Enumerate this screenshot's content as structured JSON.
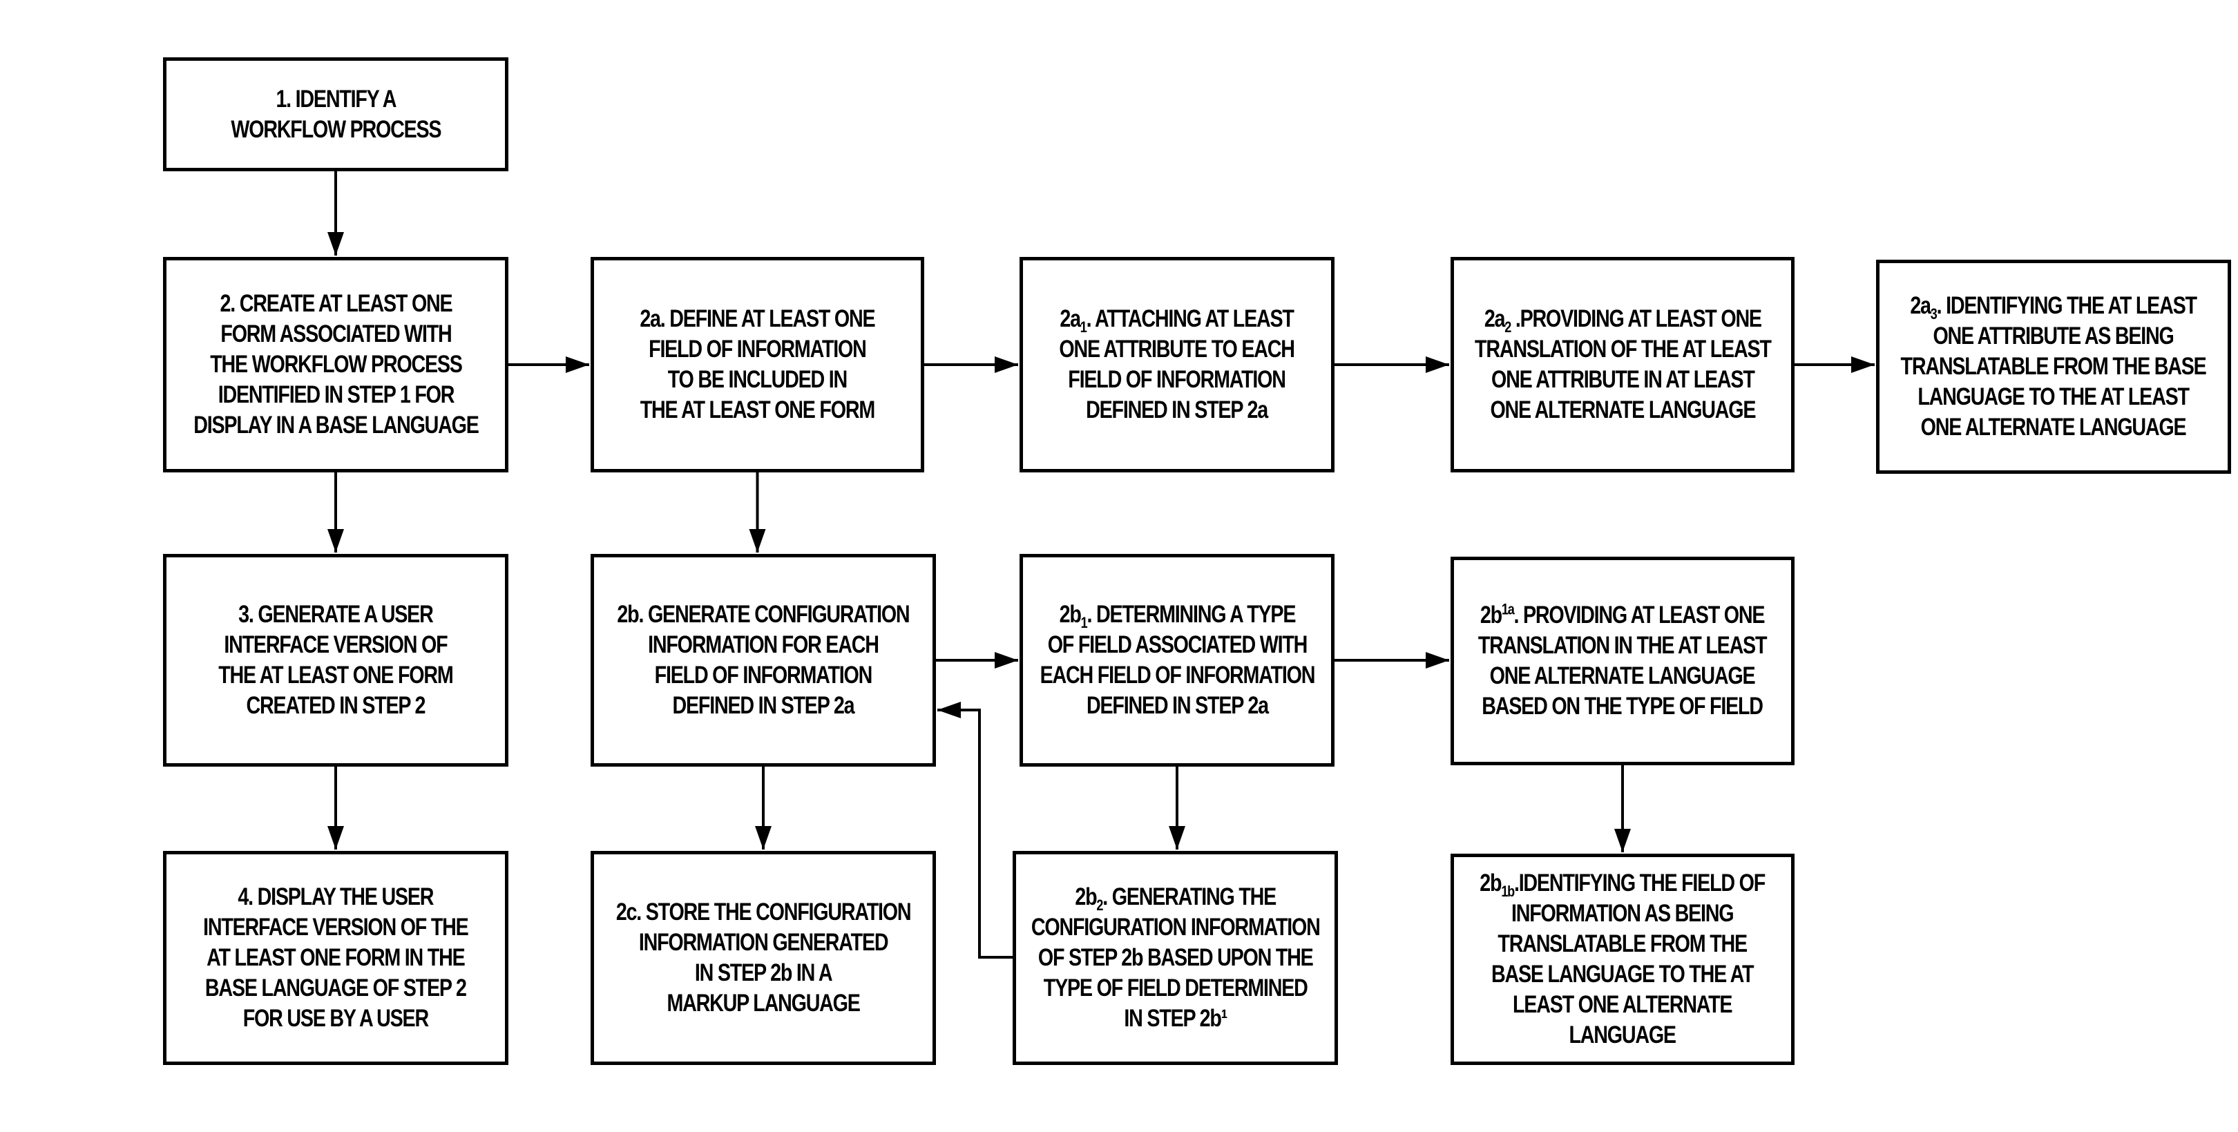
{
  "diagram": {
    "type": "flowchart",
    "colors": {
      "stroke": "#000000",
      "background": "#ffffff",
      "text": "#000000"
    },
    "nodes": [
      {
        "id": "1",
        "prefix": "1.",
        "sub": "",
        "sup": "",
        "sep": "  ",
        "lines": [
          "IDENTIFY A",
          "WORKFLOW PROCESS"
        ]
      },
      {
        "id": "2",
        "prefix": "2.",
        "sub": "",
        "sup": "",
        "sep": "  ",
        "lines": [
          "CREATE AT LEAST ONE",
          "FORM ASSOCIATED WITH",
          "THE WORKFLOW PROCESS",
          "IDENTIFIED IN STEP 1 FOR",
          "DISPLAY IN A BASE LANGUAGE"
        ]
      },
      {
        "id": "2a",
        "prefix": "2a.",
        "sub": "",
        "sup": "",
        "sep": "  ",
        "lines": [
          "DEFINE AT LEAST ONE",
          "FIELD OF INFORMATION",
          "TO BE INCLUDED IN",
          "THE AT LEAST ONE FORM"
        ]
      },
      {
        "id": "2a1",
        "prefix": "2a",
        "sub": "1",
        "sup": "",
        "sep": ". ",
        "lines": [
          "ATTACHING AT LEAST",
          "ONE ATTRIBUTE TO EACH",
          "FIELD OF INFORMATION",
          "DEFINED IN STEP 2a"
        ]
      },
      {
        "id": "2a2",
        "prefix": "2a",
        "sub": "2",
        "sup": "",
        "sep": " .",
        "lines": [
          "PROVIDING AT LEAST ONE",
          "TRANSLATION OF THE AT LEAST",
          "ONE ATTRIBUTE IN AT LEAST",
          "ONE ALTERNATE LANGUAGE"
        ]
      },
      {
        "id": "2a3",
        "prefix": "2a",
        "sub": "3",
        "sup": "",
        "sep": ". ",
        "lines": [
          "IDENTIFYING THE AT LEAST",
          "ONE ATTRIBUTE AS BEING",
          "TRANSLATABLE FROM THE BASE",
          "LANGUAGE TO THE AT LEAST",
          "ONE ALTERNATE LANGUAGE"
        ]
      },
      {
        "id": "3",
        "prefix": "3.",
        "sub": "",
        "sup": "",
        "sep": "  ",
        "lines": [
          "GENERATE A USER",
          "INTERFACE VERSION OF",
          "THE AT LEAST ONE FORM",
          "CREATED IN STEP 2"
        ]
      },
      {
        "id": "2b",
        "prefix": "2b.",
        "sub": "",
        "sup": "",
        "sep": " ",
        "lines": [
          "GENERATE CONFIGURATION",
          "INFORMATION FOR EACH",
          "FIELD OF INFORMATION",
          "DEFINED IN STEP 2a"
        ]
      },
      {
        "id": "2b1",
        "prefix": "2b",
        "sub": "1",
        "sup": "",
        "sep": ". ",
        "lines": [
          "DETERMINING A TYPE",
          "OF FIELD ASSOCIATED WITH",
          "EACH FIELD OF INFORMATION",
          "DEFINED IN STEP 2a"
        ]
      },
      {
        "id": "2b1a",
        "prefix": "2b",
        "sub": "",
        "sup": "1a",
        "sep": ". ",
        "lines": [
          "PROVIDING AT LEAST ONE",
          "TRANSLATION IN THE AT LEAST",
          "ONE ALTERNATE LANGUAGE",
          "BASED ON THE TYPE OF FIELD"
        ]
      },
      {
        "id": "4",
        "prefix": "4.",
        "sub": "",
        "sup": "",
        "sep": "  ",
        "lines": [
          "DISPLAY THE USER",
          "INTERFACE VERSION OF THE",
          "AT LEAST ONE FORM IN THE",
          "BASE LANGUAGE OF STEP 2",
          "FOR USE BY A USER"
        ]
      },
      {
        "id": "2c",
        "prefix": "2c.",
        "sub": "",
        "sup": "",
        "sep": " ",
        "lines": [
          "STORE THE CONFIGURATION",
          "INFORMATION GENERATED",
          "IN STEP 2b IN A",
          "MARKUP LANGUAGE"
        ]
      },
      {
        "id": "2b2",
        "prefix": "2b",
        "sub": "2",
        "sup": "",
        "sep": ". ",
        "lines": [
          "GENERATING THE",
          "CONFIGURATION INFORMATION",
          "OF STEP 2b BASED UPON THE",
          "TYPE OF FIELD DETERMINED",
          "IN STEP 2b¹"
        ]
      },
      {
        "id": "2b1b",
        "prefix": "2b",
        "sub": "1b",
        "sup": "",
        "sep": ".",
        "lines": [
          "IDENTIFYING THE FIELD OF",
          "INFORMATION AS BEING",
          "TRANSLATABLE FROM THE",
          "BASE LANGUAGE TO THE AT",
          "LEAST ONE ALTERNATE",
          "LANGUAGE"
        ]
      }
    ],
    "edges": [
      {
        "from": "1",
        "to": "2"
      },
      {
        "from": "2",
        "to": "2a"
      },
      {
        "from": "2a",
        "to": "2a1"
      },
      {
        "from": "2a1",
        "to": "2a2"
      },
      {
        "from": "2a2",
        "to": "2a3"
      },
      {
        "from": "2",
        "to": "3"
      },
      {
        "from": "3",
        "to": "4"
      },
      {
        "from": "2a",
        "to": "2b"
      },
      {
        "from": "2b",
        "to": "2b1"
      },
      {
        "from": "2b1",
        "to": "2b1a"
      },
      {
        "from": "2b",
        "to": "2c"
      },
      {
        "from": "2b1",
        "to": "2b2"
      },
      {
        "from": "2b2",
        "to": "2b",
        "routing": "feedback"
      },
      {
        "from": "2b1a",
        "to": "2b1b"
      }
    ]
  }
}
